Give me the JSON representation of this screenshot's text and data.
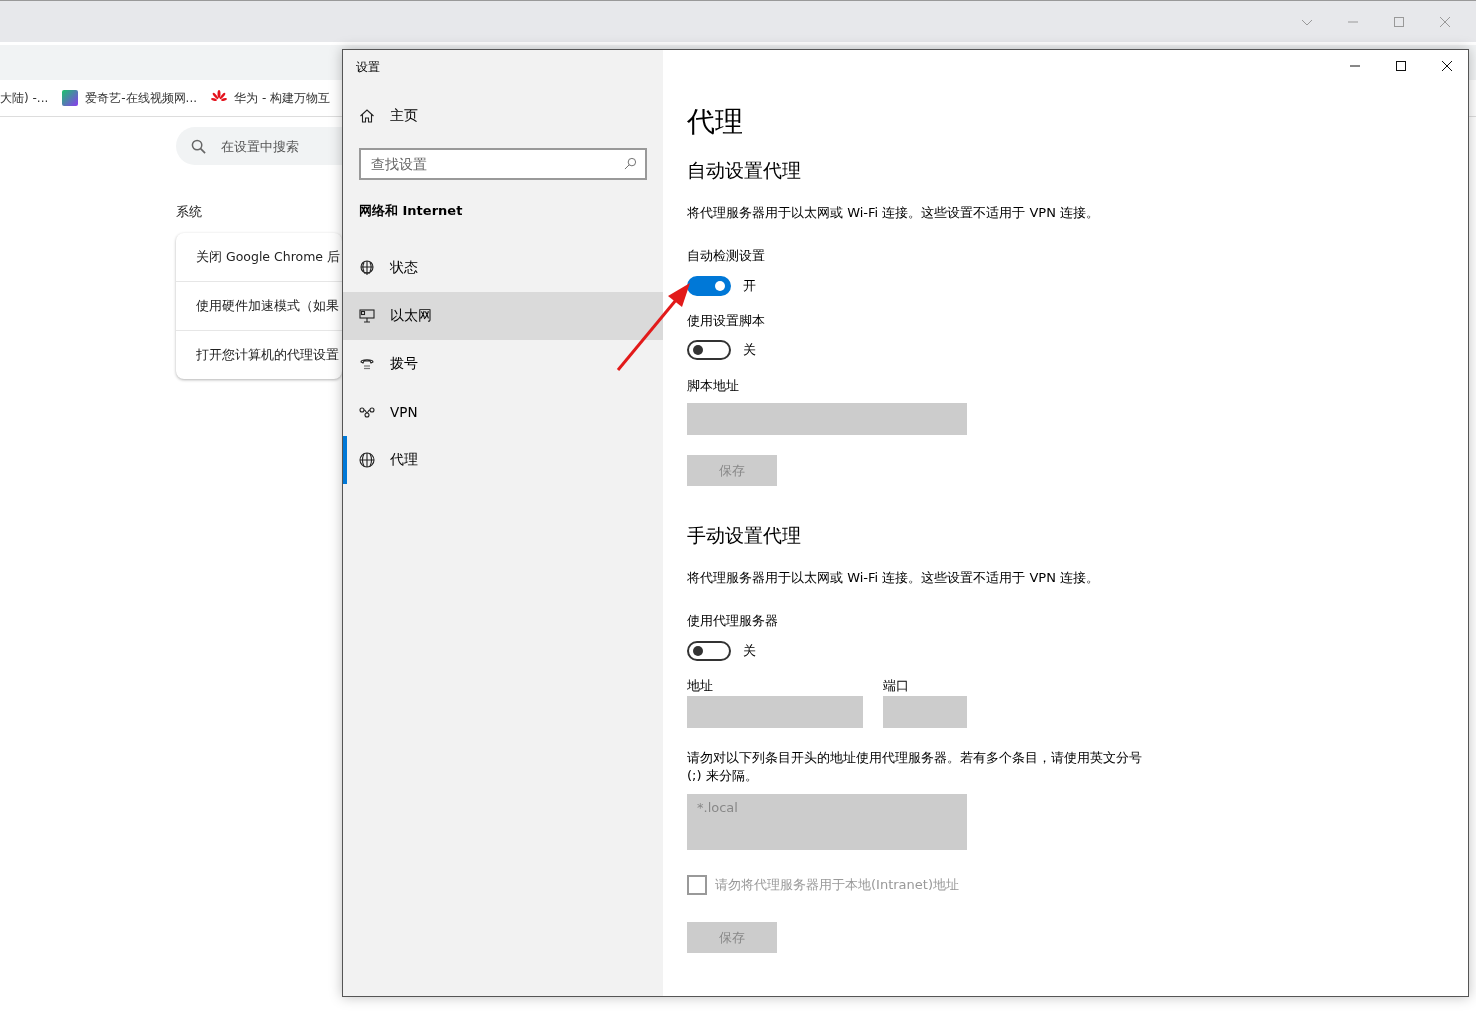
{
  "browser": {
    "bookmarks": [
      {
        "kind": "none",
        "label": "大陆) -..."
      },
      {
        "kind": "tile",
        "label": "爱奇艺-在线视频网..."
      },
      {
        "kind": "flower",
        "label": "华为 - 构建万物互"
      }
    ],
    "search": {
      "placeholder": "在设置中搜索"
    },
    "section_title": "系统",
    "rows": [
      "关闭 Google Chrome 后",
      "使用硬件加速模式（如果",
      "打开您计算机的代理设置"
    ]
  },
  "settings_window": {
    "title": "设置",
    "home": "主页",
    "search": {
      "placeholder": "查找设置"
    },
    "category": "网络和 Internet",
    "nav": [
      {
        "kind": "status",
        "label": "状态",
        "selected": false,
        "hovered": false
      },
      {
        "kind": "ethernet",
        "label": "以太网",
        "selected": false,
        "hovered": true
      },
      {
        "kind": "dialup",
        "label": "拨号",
        "selected": false,
        "hovered": false
      },
      {
        "kind": "vpn",
        "label": "VPN",
        "selected": false,
        "hovered": false
      },
      {
        "kind": "proxy",
        "label": "代理",
        "selected": true,
        "hovered": false
      }
    ]
  },
  "page": {
    "title": "代理",
    "auto": {
      "heading": "自动设置代理",
      "description": "将代理服务器用于以太网或 Wi-Fi 连接。这些设置不适用于 VPN 连接。",
      "detect": {
        "label": "自动检测设置",
        "on": true,
        "state_text": "开"
      },
      "script": {
        "label": "使用设置脚本",
        "on": false,
        "state_text": "关"
      },
      "script_address": {
        "label": "脚本地址"
      },
      "save": {
        "label": "保存",
        "disabled": true
      }
    },
    "manual": {
      "heading": "手动设置代理",
      "description": "将代理服务器用于以太网或 Wi-Fi 连接。这些设置不适用于 VPN 连接。",
      "use_proxy": {
        "label": "使用代理服务器",
        "on": false,
        "state_text": "关"
      },
      "address": {
        "label": "地址"
      },
      "port": {
        "label": "端口"
      },
      "exceptions_note": "请勿对以下列条目开头的地址使用代理服务器。若有多个条目，请使用英文分号 (;) 来分隔。",
      "exceptions": {
        "value": "*.local"
      },
      "local_bypass": {
        "label": "请勿将代理服务器用于本地(Intranet)地址",
        "checked": false,
        "disabled": true
      },
      "save": {
        "label": "保存",
        "disabled": true
      }
    }
  }
}
